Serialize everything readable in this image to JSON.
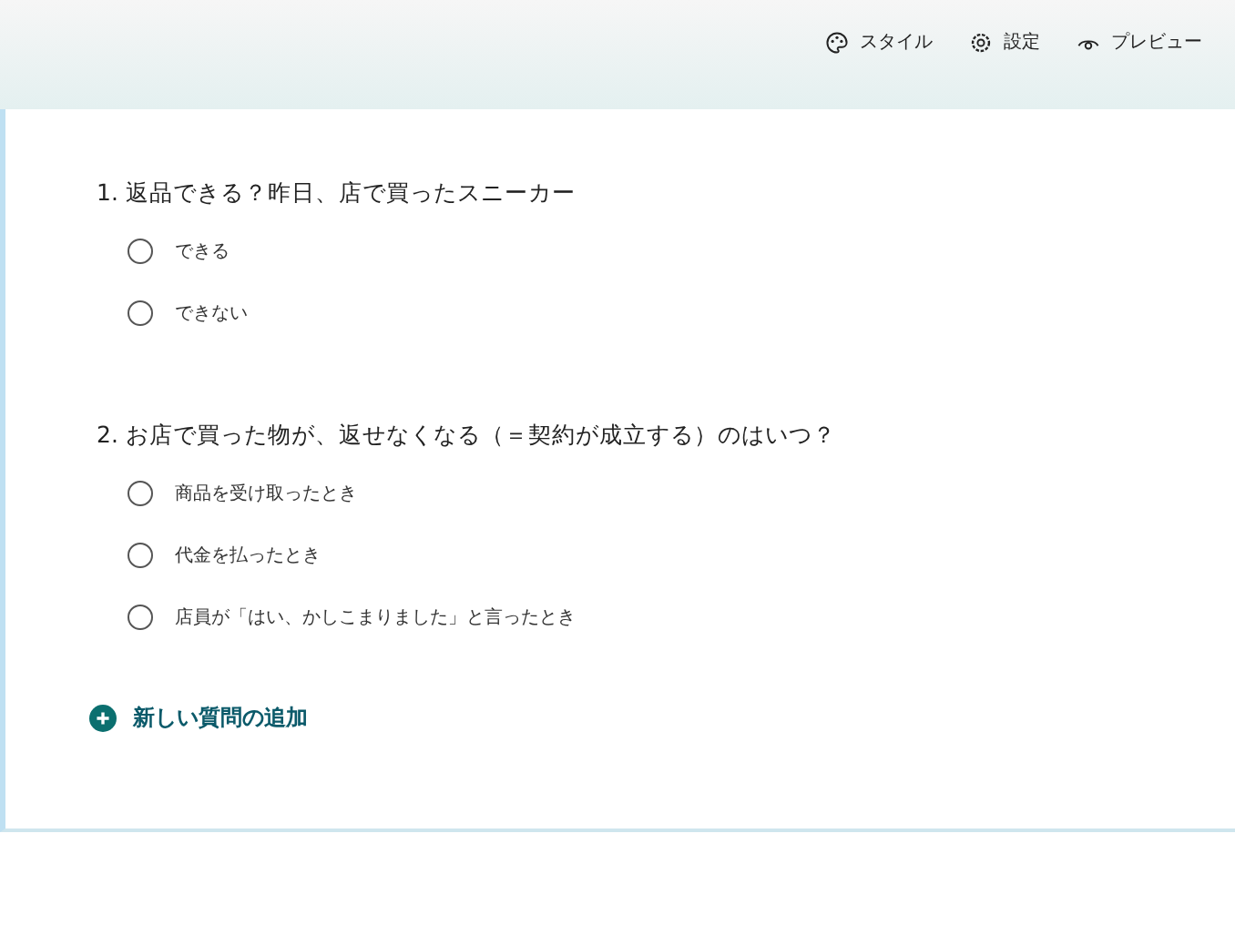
{
  "toolbar": [
    {
      "kind": "style",
      "label": "スタイル"
    },
    {
      "kind": "settings",
      "label": "設定"
    },
    {
      "kind": "preview",
      "label": "プレビュー"
    }
  ],
  "questions": [
    {
      "title": "1. 返品できる？昨日、店で買ったスニーカー",
      "options": [
        {
          "label": "できる",
          "selected": false
        },
        {
          "label": "できない",
          "selected": false
        }
      ]
    },
    {
      "title": "2. お店で買った物が、返せなくなる（＝契約が成立する）のはいつ？",
      "options": [
        {
          "label": "商品を受け取ったとき",
          "selected": false
        },
        {
          "label": "代金を払ったとき",
          "selected": false
        },
        {
          "label": "店員が「はい、かしこまりました」と言ったとき",
          "selected": false
        }
      ]
    }
  ],
  "add_button": {
    "label": "新しい質問の追加"
  }
}
